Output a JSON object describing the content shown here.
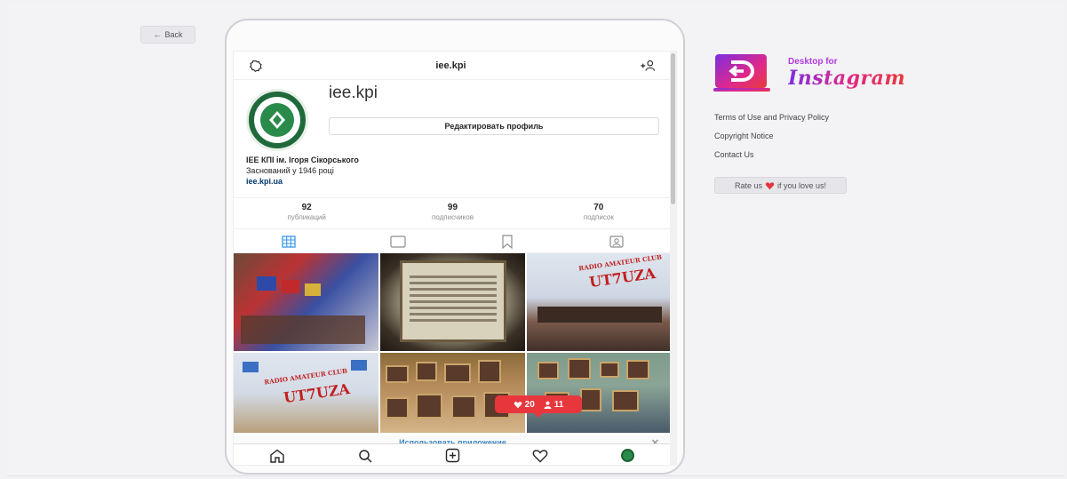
{
  "nav": {
    "back_label": "Back"
  },
  "instagram": {
    "header_title": "iee.kpi",
    "username": "iee.kpi",
    "edit_profile_label": "Редактировать профиль",
    "bio_name": "IEE КПІ ім. Ігоря Сікорського",
    "bio_line": "Заснований у 1946 році",
    "bio_link": "iee.kpi.ua",
    "stats": [
      {
        "value": "92",
        "label": "публикаций"
      },
      {
        "value": "99",
        "label": "подписчиков"
      },
      {
        "value": "70",
        "label": "подписок"
      }
    ],
    "photo_texts": {
      "club_line": "RADIO AMATEUR CLUB",
      "callsign": "UT7UZA"
    },
    "banner_text": "Использовать приложение",
    "banner_close": "✕",
    "notification": {
      "likes": "20",
      "followers": "11"
    }
  },
  "sidebar": {
    "brand_small": "Desktop for",
    "brand_big": "Instagram",
    "links": [
      "Terms of Use and Privacy Policy",
      "Copyright Notice",
      "Contact Us"
    ],
    "rate_pre": "Rate us",
    "rate_post": "if you love us!"
  },
  "colors": {
    "accent_red": "#e8363d",
    "link_blue": "#3b87c4",
    "brand_gradient_start": "#7c2fe0",
    "brand_gradient_end": "#e73b3b"
  },
  "icons": [
    "arrow-left-icon",
    "settings-icon",
    "add-user-icon",
    "grid-icon",
    "igtv-icon",
    "bookmark-icon",
    "tagged-icon",
    "home-icon",
    "search-icon",
    "plus-square-icon",
    "heart-icon",
    "heart-filled-icon",
    "user-icon"
  ]
}
